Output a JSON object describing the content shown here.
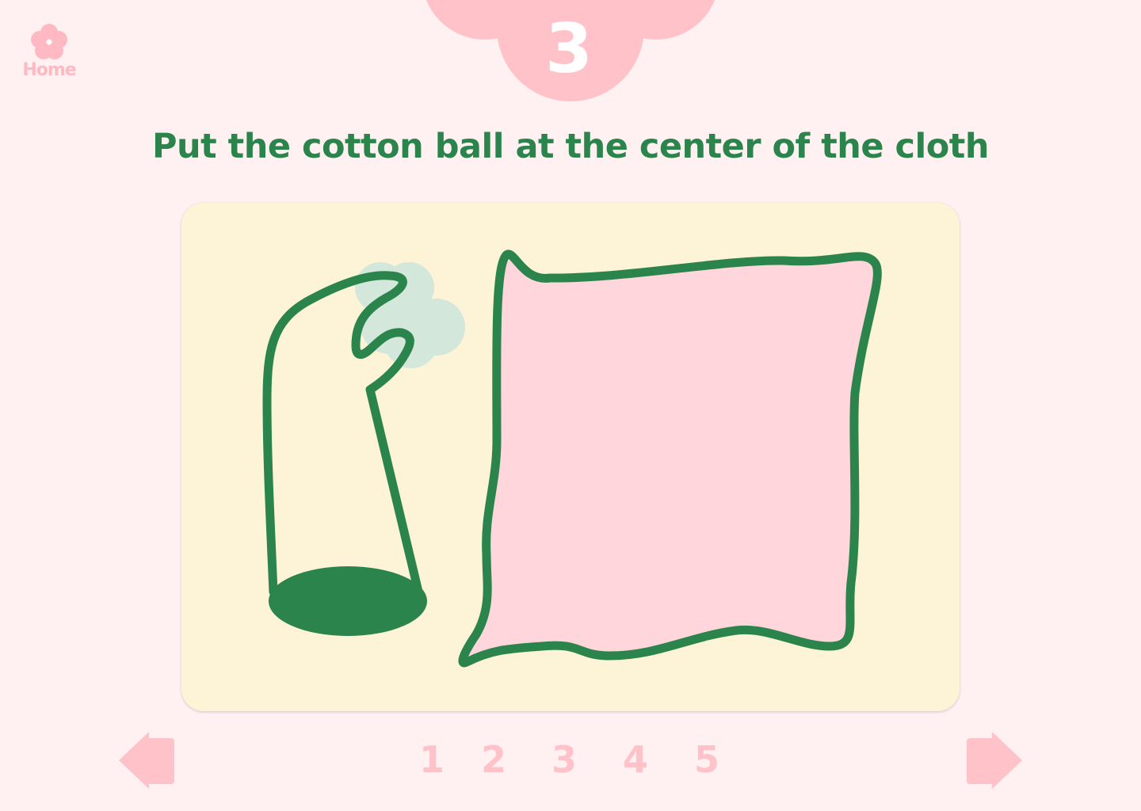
{
  "home": {
    "label": "Home",
    "icon": "flower-icon",
    "color": "#ffb9c2"
  },
  "step": {
    "number": "3",
    "badge_color": "#ffc2c9"
  },
  "instruction": {
    "text": "Put the cotton ball at the center of the cloth",
    "color": "#2b844c"
  },
  "stage": {
    "background": "#fdf3d6",
    "items": [
      {
        "name": "hand-icon",
        "description": "outlined hand with thumb"
      },
      {
        "name": "cotton-ball",
        "color": "#d3e7db"
      },
      {
        "name": "cloth",
        "color": "#fed6dc",
        "outline": "#2b844c"
      }
    ]
  },
  "navigation": {
    "prev_icon": "arrow-left-icon",
    "next_icon": "arrow-right-icon",
    "color": "#ffc2c9"
  },
  "pager": {
    "pages": [
      "1",
      "2",
      "3",
      "4",
      "5"
    ]
  }
}
